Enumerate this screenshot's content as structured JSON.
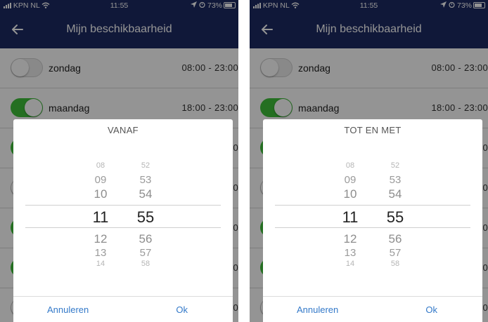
{
  "status": {
    "carrier": "KPN NL",
    "time": "11:55",
    "battery": "73%"
  },
  "nav": {
    "title": "Mijn beschikbaarheid"
  },
  "rows": [
    {
      "day": "zondag",
      "hours": "08:00 - 23:00",
      "on": false
    },
    {
      "day": "maandag",
      "hours": "18:00 - 23:00",
      "on": true
    },
    {
      "day": "",
      "hours": "0",
      "on": true
    },
    {
      "day": "",
      "hours": "0",
      "on": false
    },
    {
      "day": "",
      "hours": "0",
      "on": true
    },
    {
      "day": "",
      "hours": "0",
      "on": true
    },
    {
      "day": "",
      "hours": "0",
      "on": false
    }
  ],
  "dialogs": [
    {
      "title": "VANAF",
      "hours": [
        "08",
        "09",
        "10",
        "11",
        "12",
        "13",
        "14"
      ],
      "minutes": [
        "52",
        "53",
        "54",
        "55",
        "56",
        "57",
        "58"
      ],
      "selected_hour": "11",
      "selected_minute": "55",
      "cancel_label": "Annuleren",
      "ok_label": "Ok"
    },
    {
      "title": "TOT EN MET",
      "hours": [
        "08",
        "09",
        "10",
        "11",
        "12",
        "13",
        "14"
      ],
      "minutes": [
        "52",
        "53",
        "54",
        "55",
        "56",
        "57",
        "58"
      ],
      "selected_hour": "11",
      "selected_minute": "55",
      "cancel_label": "Annuleren",
      "ok_label": "Ok"
    }
  ],
  "colors": {
    "navbar": "#1d2a63",
    "toggle_on": "#3fbf3a",
    "button": "#3379c9"
  },
  "icons": {
    "back": "arrow-left-icon",
    "wifi": "wifi-icon",
    "location": "location-arrow-icon",
    "alarm": "alarm-icon",
    "battery": "battery-icon"
  }
}
